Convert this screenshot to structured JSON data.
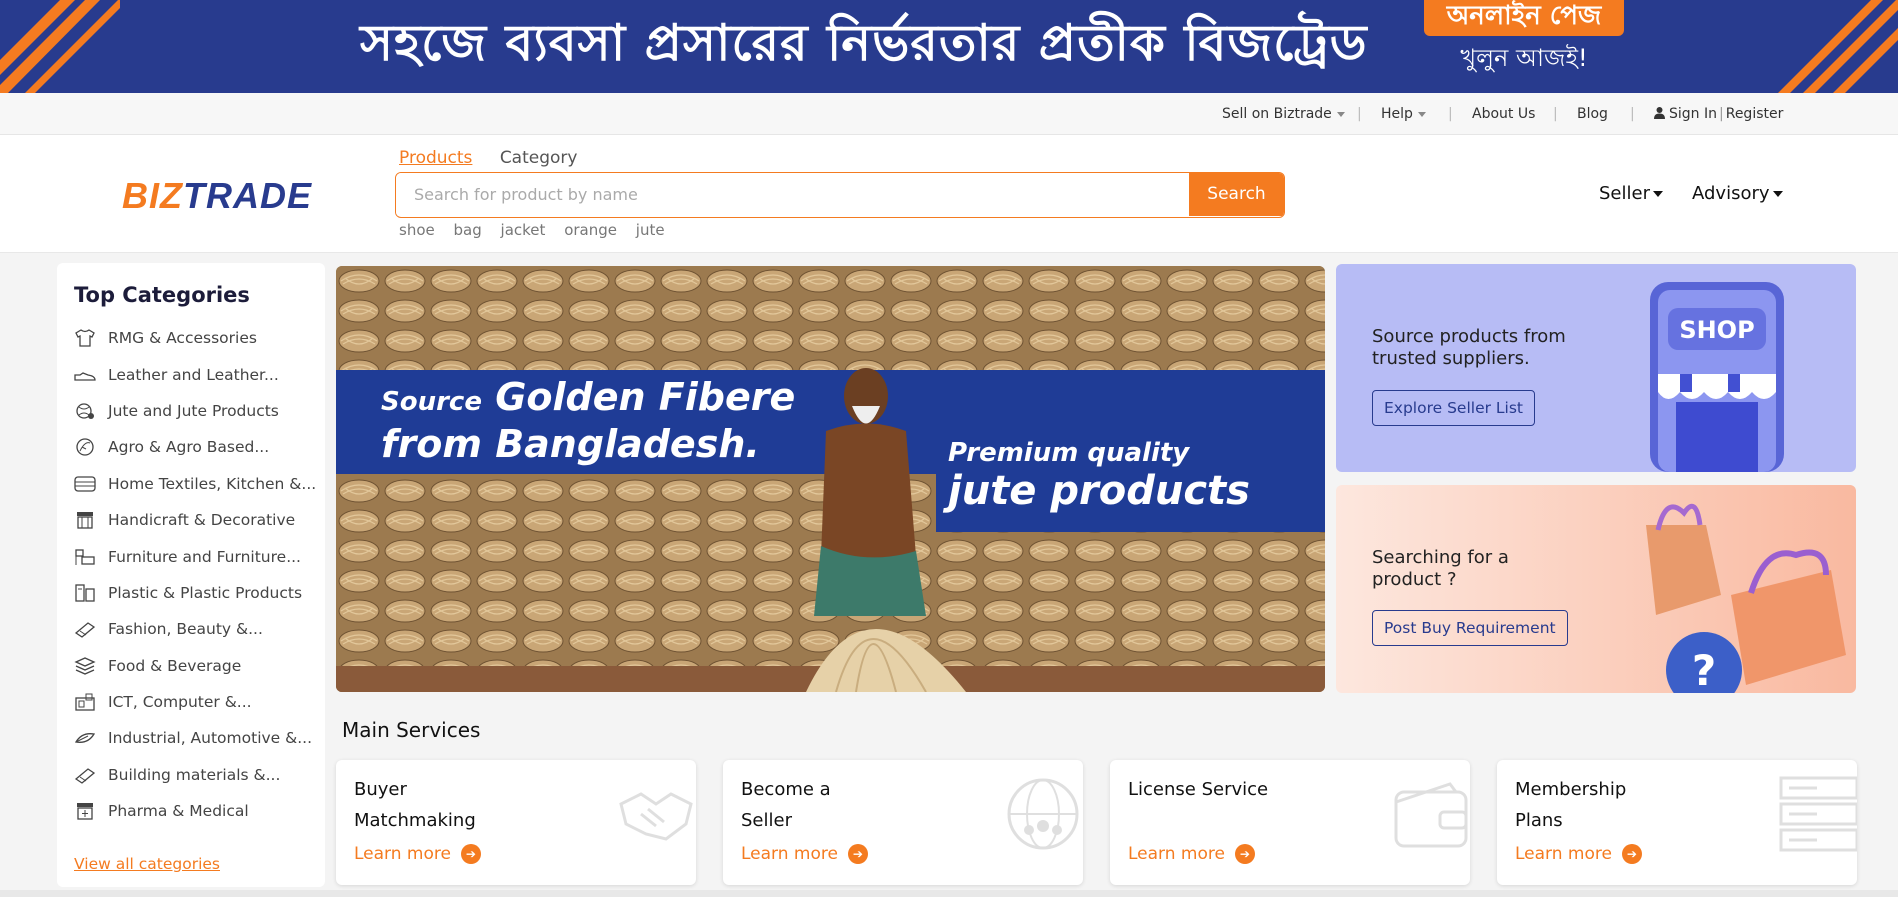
{
  "banner": {
    "headline": "সহজে ব্যবসা প্রসারের নির্ভরতার প্রতীক বিজট্রেড",
    "cta": "অনলাইন পেজ",
    "cta_sub": "খুলুন আজই!"
  },
  "util_nav": {
    "sell": "Sell on Biztrade",
    "help": "Help",
    "about": "About Us",
    "blog": "Blog",
    "signin": "Sign In",
    "register": "Register"
  },
  "header": {
    "logo_biz": "BIZ",
    "logo_trade": "TRADE",
    "tabs": [
      "Products",
      "Category"
    ],
    "search_placeholder": "Search for product by name",
    "search_button": "Search",
    "suggestions": [
      "shoe",
      "bag",
      "jacket",
      "orange",
      "jute"
    ],
    "seller": "Seller",
    "advisory": "Advisory"
  },
  "sidebar": {
    "title": "Top Categories",
    "items": [
      {
        "label": "RMG & Accessories",
        "icon": "tshirt-icon"
      },
      {
        "label": "Leather and Leather...",
        "icon": "shoe-icon"
      },
      {
        "label": "Jute and Jute Products",
        "icon": "jute-icon"
      },
      {
        "label": "Agro & Agro Based...",
        "icon": "agro-icon"
      },
      {
        "label": "Home Textiles, Kitchen &...",
        "icon": "textile-icon"
      },
      {
        "label": "Handicraft & Decorative",
        "icon": "handicraft-icon"
      },
      {
        "label": "Furniture and Furniture...",
        "icon": "furniture-icon"
      },
      {
        "label": "Plastic & Plastic Products",
        "icon": "plastic-icon"
      },
      {
        "label": "Fashion, Beauty &...",
        "icon": "fashion-icon"
      },
      {
        "label": "Food & Beverage",
        "icon": "food-icon"
      },
      {
        "label": "ICT, Computer &...",
        "icon": "computer-icon"
      },
      {
        "label": "Industrial, Automotive &...",
        "icon": "industrial-icon"
      },
      {
        "label": "Building materials &...",
        "icon": "building-icon"
      },
      {
        "label": "Pharma & Medical",
        "icon": "pharma-icon"
      }
    ],
    "view_all": "View all categories"
  },
  "hero": {
    "source_word": "Source",
    "line1": "Golden Fibere",
    "line2": "from Bangladesh.",
    "premium": "Premium quality",
    "jute": "jute products"
  },
  "promos": {
    "p1_text1": "Source products from",
    "p1_text2": "trusted suppliers.",
    "p1_button": "Explore Seller List",
    "p1_shop": "SHOP",
    "p2_text1": "Searching for a",
    "p2_text2": "product ?",
    "p2_button": "Post Buy Requirement"
  },
  "services": {
    "title": "Main Services",
    "learn_more": "Learn more",
    "cards": [
      {
        "line1": "Buyer",
        "line2": "Matchmaking",
        "icon": "handshake-icon"
      },
      {
        "line1": "Become a",
        "line2": "Seller",
        "icon": "globe-people-icon"
      },
      {
        "line1": "License Service",
        "line2": "",
        "icon": "wallet-icon"
      },
      {
        "line1": "Membership",
        "line2": "Plans",
        "icon": "server-icon"
      }
    ]
  },
  "colors": {
    "accent": "#f47b20",
    "brand": "#283b8e"
  }
}
